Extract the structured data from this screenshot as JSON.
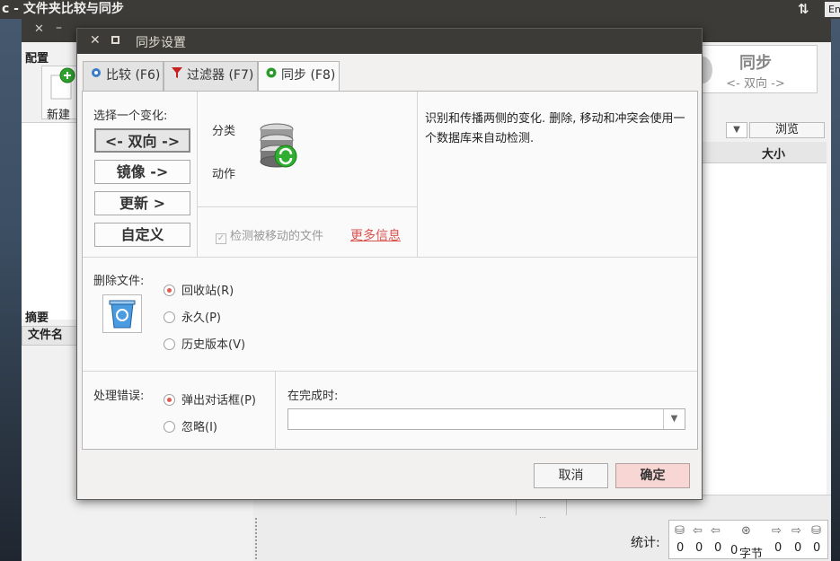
{
  "desktop": {
    "window_title": "c - 文件夹比较与同步",
    "keyboard_indicator": "En"
  },
  "mainwin": {
    "config_label": "配置",
    "new_label": "新建",
    "summary_label": "摘要",
    "filename_header": "文件名",
    "sync_title": "同步",
    "sync_direction": "<- 双向 ->",
    "browse_label": "浏览",
    "size_header": "大小",
    "stats_label": "统计:",
    "stats_values": [
      "0",
      "0",
      "0",
      "0",
      "字节",
      "0",
      "0",
      "0"
    ]
  },
  "dialog": {
    "title": "同步设置",
    "tabs": [
      {
        "label": "比较 (F6)",
        "icon": "gear-icon"
      },
      {
        "label": "过滤器 (F7)",
        "icon": "filter-icon"
      },
      {
        "label": "同步 (F8)",
        "icon": "sync-gear-icon"
      }
    ],
    "choose_variant_label": "选择一个变化:",
    "variants": [
      "<- 双向 ->",
      "镜像 ->",
      "更新 >",
      "自定义"
    ],
    "category_label": "分类",
    "action_label": "动作",
    "detect_moved_label": "检测被移动的文件",
    "more_info_label": "更多信息",
    "description": "识别和传播两侧的变化. 删除, 移动和冲突会使用一个数据库来自动检测.",
    "delete_files_label": "删除文件:",
    "delete_options": [
      "回收站(R)",
      "永久(P)",
      "历史版本(V)"
    ],
    "handle_errors_label": "处理错误:",
    "error_options": [
      "弹出对话框(P)",
      "忽略(I)"
    ],
    "on_completion_label": "在完成时:",
    "on_completion_value": "",
    "cancel_label": "取消",
    "ok_label": "确定",
    "colors": {
      "title_bar": "#3c3b37",
      "accent_red": "#e05a4e",
      "ok_button": "#f8d6d4",
      "link": "#d9534f"
    }
  }
}
